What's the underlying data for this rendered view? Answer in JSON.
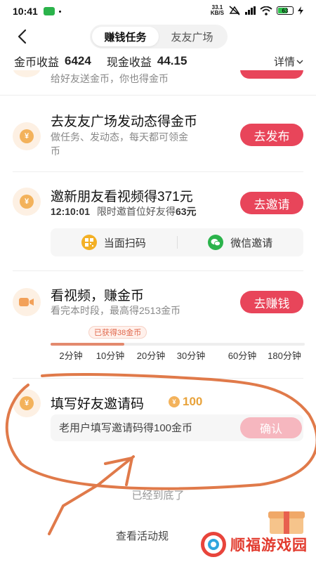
{
  "status_bar": {
    "time": "10:41",
    "net_speed_top": "33.1",
    "net_speed_unit": "KB/S",
    "battery": "63"
  },
  "header": {
    "tabs": [
      {
        "label": "赚钱任务",
        "active": true
      },
      {
        "label": "友友广场",
        "active": false
      }
    ]
  },
  "income": {
    "coin_label": "金币收益",
    "coin_value": "6424",
    "cash_label": "现金收益",
    "cash_value": "44.15",
    "detail_label": "详情"
  },
  "tasks": {
    "partial": {
      "desc": "给好友送金币，你也得金币"
    },
    "post": {
      "title": "去友友广场发动态得金币",
      "desc_line1": "做任务、发动态，每天都可领金",
      "desc_line2": "币",
      "button": "去发布",
      "icon": "coin-icon"
    },
    "invite": {
      "title": "邀新朋友看视频得371元",
      "timer": "12:10:01",
      "desc": "限时邀首位好友得",
      "desc_amount": "63元",
      "button": "去邀请",
      "options": [
        {
          "label": "当面扫码",
          "icon": "qr-code-icon"
        },
        {
          "label": "微信邀请",
          "icon": "wechat-icon"
        }
      ]
    },
    "video": {
      "title": "看视频，赚金币",
      "desc": "看完本时段，最高得2513金币",
      "button": "去赚钱",
      "icon": "video-camera-icon",
      "earned_badge": "已获得38金币",
      "progress_fraction": 0.29,
      "ticks": [
        "2分钟",
        "10分钟",
        "20分钟",
        "30分钟",
        "60分钟",
        "180分钟"
      ]
    },
    "code": {
      "title": "填写好友邀请码",
      "reward": "100",
      "placeholder": "老用户填写邀请码得100金币",
      "button": "确认"
    }
  },
  "footer": {
    "end_text": "已经到底了",
    "rules_link": "查看活动规"
  },
  "watermark": {
    "text": "顺福游戏园"
  },
  "colors": {
    "accent": "#e8455a",
    "coin": "#f3b25b",
    "annotation": "#e07a4a"
  }
}
